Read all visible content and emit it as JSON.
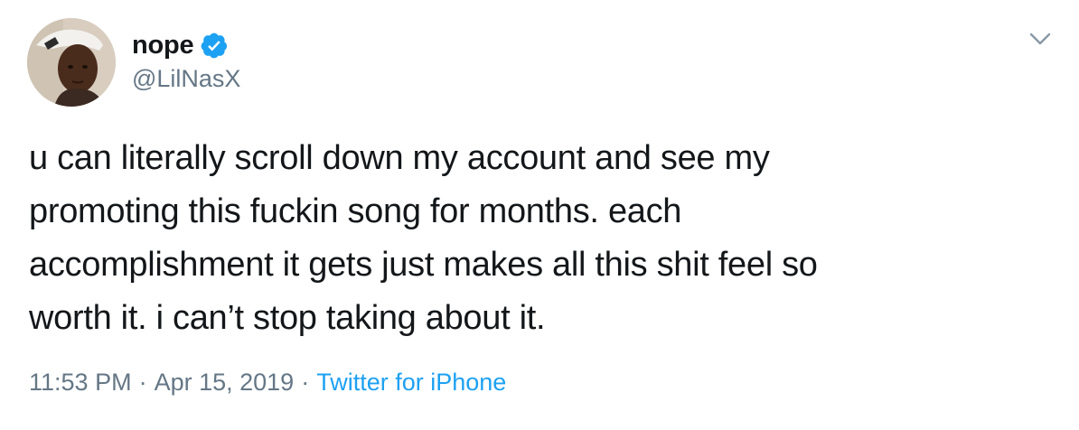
{
  "user": {
    "display_name": "nope",
    "handle": "@LilNasX",
    "verified": true
  },
  "tweet": {
    "text": "u can literally scroll down my account and see my\npromoting this fuckin song for months. each\naccomplishment it gets just makes all this shit feel so\nworth it. i can’t stop taking about it.",
    "time": "11:53 PM",
    "date": "Apr 15, 2019",
    "separator": "·",
    "source": "Twitter for iPhone"
  },
  "icons": {
    "avatar": "avatar-photo",
    "verified": "verified-badge-icon",
    "more": "chevron-down-icon"
  },
  "colors": {
    "text": "#14171a",
    "secondary": "#657786",
    "link": "#1da1f2",
    "verified": "#1da1f2"
  }
}
